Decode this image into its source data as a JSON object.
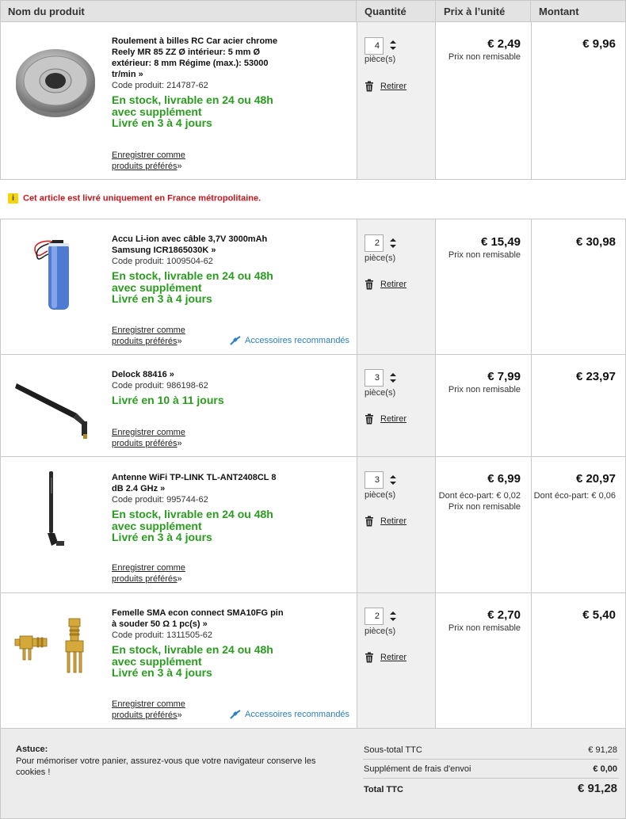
{
  "header": {
    "product": "Nom du produit",
    "quantity": "Quantité",
    "unit_price": "Prix à l’unité",
    "amount": "Montant"
  },
  "common": {
    "unit": "pièce(s)",
    "remove": "Retirer",
    "fav1": "Enregistrer comme",
    "fav2": "produits préférés",
    "fav_arrow": "»",
    "no_discount": "Prix non remisable",
    "accessories": "Accessoires recommandés"
  },
  "notice": {
    "icon": "i",
    "text": "Cet article est livré uniquement en France métropolitaine."
  },
  "items": [
    {
      "name": "Roulement à billes RC Car acier chrome Reely MR 85 ZZ Ø intérieur: 5 mm Ø extérieur: 8 mm Régime (max.): 53000 tr/min »",
      "code": "Code produit: 214787-62",
      "stock": [
        "En stock, livrable en 24 ou 48h",
        "avec supplément",
        "Livré en 3 à 4 jours"
      ],
      "qty": "4",
      "price": "€ 2,49",
      "amount": "€ 9,96",
      "icon": "bearing-icon"
    },
    {
      "name": "Accu Li-ion avec câble 3,7V 3000mAh Samsung ICR1865030K »",
      "code": "Code produit: 1009504-62",
      "stock": [
        "En stock, livrable en 24 ou 48h",
        "avec supplément",
        "Livré en 3 à 4 jours"
      ],
      "qty": "2",
      "price": "€ 15,49",
      "amount": "€ 30,98",
      "icon": "battery-icon"
    },
    {
      "name": "Delock 88416 »",
      "code": "Code produit: 986198-62",
      "stock": [
        "Livré en 10 à 11 jours"
      ],
      "qty": "3",
      "price": "€ 7,99",
      "amount": "€ 23,97",
      "icon": "antenna-icon"
    },
    {
      "name": "Antenne WiFi TP-LINK TL-ANT2408CL 8 dB 2.4 GHz »",
      "code": "Code produit: 995744-62",
      "stock": [
        "En stock, livrable en 24 ou 48h",
        "avec supplément",
        "Livré en 3 à 4 jours"
      ],
      "qty": "3",
      "price": "€ 6,99",
      "eco_price": "Dont éco-part: € 0,02",
      "amount": "€ 20,97",
      "eco_amount": "Dont éco-part: € 0,06",
      "icon": "wifi-antenna-icon"
    },
    {
      "name": "Femelle SMA econ connect SMA10FG pin à souder 50 Ω 1 pc(s) »",
      "code": "Code produit: 1311505-62",
      "stock": [
        "En stock, livrable en 24 ou 48h",
        "avec supplément",
        "Livré en 3 à 4 jours"
      ],
      "qty": "2",
      "price": "€ 2,70",
      "amount": "€ 5,40",
      "icon": "sma-connector-icon"
    }
  ],
  "footer": {
    "tip_title": "Astuce:",
    "tip_text": "Pour mémoriser votre panier, assurez-vous que votre navigateur conserve les cookies !",
    "subtotal_label": "Sous-total TTC",
    "subtotal": "€ 91,28",
    "shipping_label": "Supplément de frais d'envoi",
    "shipping": "€ 0,00",
    "total_label": "Total TTC",
    "total": "€ 91,28"
  },
  "colors": {
    "stock_green": "#2a9d1f",
    "notice_red": "#c4161c",
    "link_blue": "#2a7fbf"
  }
}
